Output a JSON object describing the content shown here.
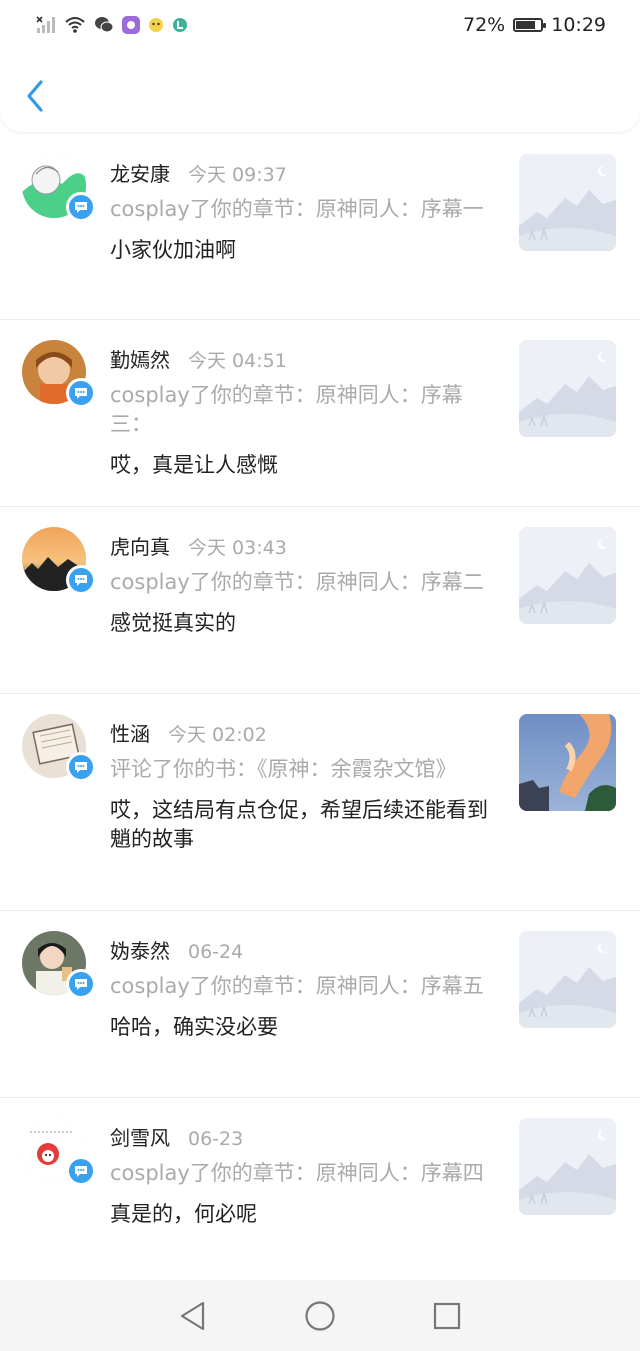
{
  "status_bar": {
    "battery": "72%",
    "time": "10:29",
    "battery_level": 0.72
  },
  "header": {
    "back_icon": "chevron-left-icon",
    "accent": "#2f9ae8"
  },
  "items": [
    {
      "name": "龙安康",
      "time": "今天 09:37",
      "action": "cosplay了你的章节：原神同人：序幕一",
      "comment": "小家伙加油啊",
      "thumb": "placeholder-mountain",
      "avatar": "green-sketch"
    },
    {
      "name": "勤嫣然",
      "time": "今天 04:51",
      "action": "cosplay了你的章节：原神同人：序幕三：",
      "comment": "哎，真是让人感慨",
      "thumb": "placeholder-mountain",
      "avatar": "child-photo"
    },
    {
      "name": "虎向真",
      "time": "今天 03:43",
      "action": "cosplay了你的章节：原神同人：序幕二",
      "comment": "感觉挺真实的",
      "thumb": "placeholder-mountain",
      "avatar": "sunset-photo"
    },
    {
      "name": "性涵",
      "time": "今天 02:02",
      "action": "评论了你的书：《原神：余霞杂文馆》",
      "comment": "哎，这结局有点仓促，希望后续还能看到魈的故事",
      "thumb": "sunset-clouds",
      "avatar": "book-photo"
    },
    {
      "name": "妫泰然",
      "time": "06-24",
      "action": "cosplay了你的章节：原神同人：序幕五",
      "comment": "哈哈，确实没必要",
      "thumb": "placeholder-mountain",
      "avatar": "person-photo"
    },
    {
      "name": "剑雪风",
      "time": "06-23",
      "action": "cosplay了你的章节：原神同人：序幕四",
      "comment": "真是的，何必呢",
      "thumb": "placeholder-mountain",
      "avatar": "cartoon-doodle"
    }
  ],
  "navbar": {
    "back_icon": "triangle-back-icon",
    "home_icon": "circle-home-icon",
    "recent_icon": "square-recents-icon"
  }
}
